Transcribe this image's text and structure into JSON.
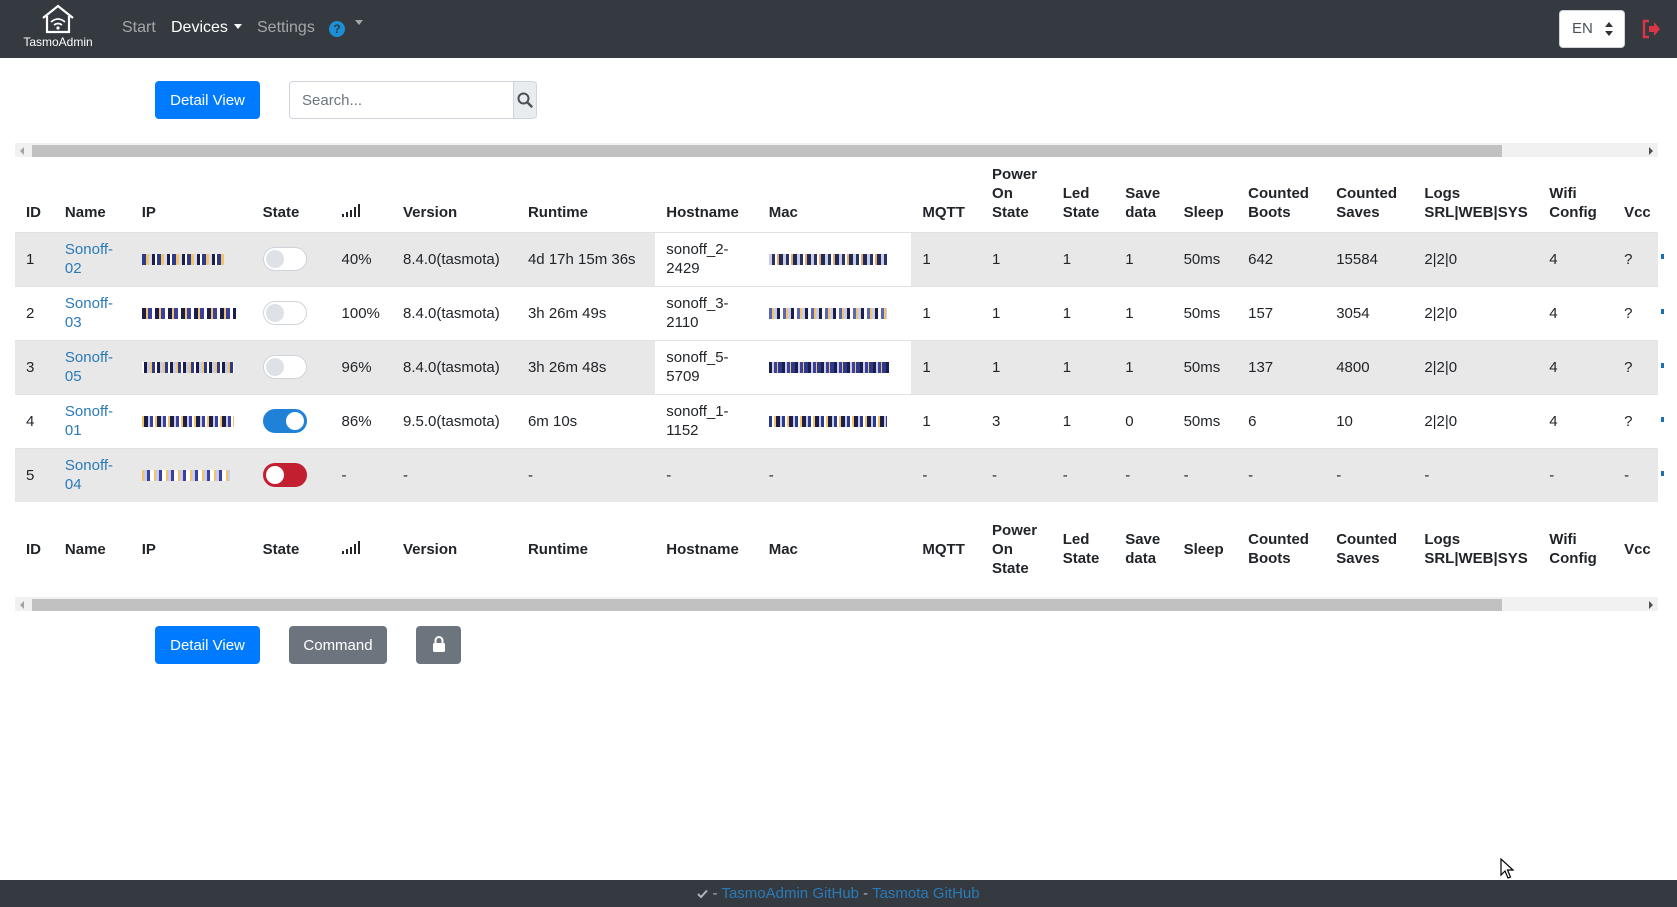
{
  "navbar": {
    "brand": "TasmoAdmin",
    "items": [
      {
        "label": "Start",
        "active": false
      },
      {
        "label": "Devices",
        "active": true,
        "dropdown": true
      },
      {
        "label": "Settings",
        "active": false
      }
    ],
    "help_icon": "question-circle-icon",
    "language": "EN",
    "logout_icon": "sign-out-icon",
    "logout_color": "#dc3545"
  },
  "toolbar": {
    "detail_view_label": "Detail View",
    "search_placeholder": "Search...",
    "search_icon": "search-icon"
  },
  "table": {
    "columns": [
      "ID",
      "Name",
      "IP",
      "State",
      "",
      "Version",
      "Runtime",
      "Hostname",
      "Mac",
      "MQTT",
      "Power On State",
      "Led State",
      "Save data",
      "Sleep",
      "Counted Boots",
      "Counted Saves",
      "Logs SRL|WEB|SYS",
      "Wifi Config",
      "Vcc"
    ],
    "rows": [
      {
        "id": "1",
        "name": "Sonoff-02",
        "state": "off",
        "signal": "40%",
        "version": "8.4.0(tasmota)",
        "runtime": "4d 17h 15m 36s",
        "hostname": "sonoff_2-2429",
        "mqtt": "1",
        "power_on_state": "1",
        "led_state": "1",
        "save_data": "1",
        "sleep": "50ms",
        "boots": "642",
        "saves": "15584",
        "logs": "2|2|0",
        "wifi": "4",
        "vcc": "?"
      },
      {
        "id": "2",
        "name": "Sonoff-03",
        "state": "off",
        "signal": "100%",
        "version": "8.4.0(tasmota)",
        "runtime": "3h 26m 49s",
        "hostname": "sonoff_3-2110",
        "mqtt": "1",
        "power_on_state": "1",
        "led_state": "1",
        "save_data": "1",
        "sleep": "50ms",
        "boots": "157",
        "saves": "3054",
        "logs": "2|2|0",
        "wifi": "4",
        "vcc": "?"
      },
      {
        "id": "3",
        "name": "Sonoff-05",
        "state": "off",
        "signal": "96%",
        "version": "8.4.0(tasmota)",
        "runtime": "3h 26m 48s",
        "hostname": "sonoff_5-5709",
        "mqtt": "1",
        "power_on_state": "1",
        "led_state": "1",
        "save_data": "1",
        "sleep": "50ms",
        "boots": "137",
        "saves": "4800",
        "logs": "2|2|0",
        "wifi": "4",
        "vcc": "?"
      },
      {
        "id": "4",
        "name": "Sonoff-01",
        "state": "on",
        "signal": "86%",
        "version": "9.5.0(tasmota)",
        "runtime": "6m 10s",
        "hostname": "sonoff_1-1152",
        "mqtt": "1",
        "power_on_state": "3",
        "led_state": "1",
        "save_data": "0",
        "sleep": "50ms",
        "boots": "6",
        "saves": "10",
        "logs": "2|2|0",
        "wifi": "4",
        "vcc": "?"
      },
      {
        "id": "5",
        "name": "Sonoff-04",
        "state": "error",
        "signal": "-",
        "version": "-",
        "runtime": "-",
        "hostname": "-",
        "mac": "-",
        "mqtt": "-",
        "power_on_state": "-",
        "led_state": "-",
        "save_data": "-",
        "sleep": "-",
        "boots": "-",
        "saves": "-",
        "logs": "-",
        "wifi": "-",
        "vcc": "-"
      }
    ]
  },
  "bottom_toolbar": {
    "detail_view_label": "Detail View",
    "command_label": "Command",
    "lock_icon": "lock-icon"
  },
  "footer": {
    "check_icon": "check-icon",
    "sep1": " - ",
    "link1": "TasmoAdmin GitHub",
    "sep2": " - ",
    "link2": "Tasmota GitHub"
  },
  "colors": {
    "navbar_bg": "#343a40",
    "primary": "#007bff",
    "secondary": "#6c757d",
    "switch_on": "#1f82d6",
    "switch_error": "#c21f30",
    "link": "#2a7ab8"
  }
}
